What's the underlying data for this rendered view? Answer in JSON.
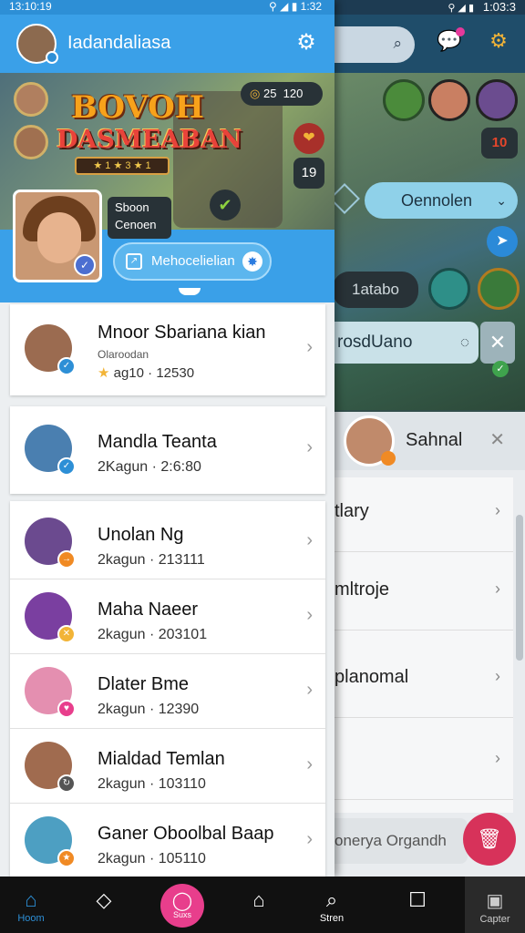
{
  "status_bar": {
    "time_left": "13:10:19",
    "time_right": "1:32",
    "time_far": "1:03:3"
  },
  "app_bar": {
    "title": "Iadandaliasa"
  },
  "banner": {
    "title_line1": "BOVOH",
    "title_line2": "DASMEABAN",
    "stars": "★ 1 ★ 3 ★ 1",
    "score_a": "25",
    "score_b": "120",
    "count": "19"
  },
  "promo": {
    "bubble_line1": "Sboon",
    "bubble_line2": "Cenoen",
    "button_label": "Mehocelielian"
  },
  "friends_top": [
    {
      "name": "Mnoor Sbariana kian",
      "tag": "Olaroodan",
      "rating": "ag10",
      "meta": "12530"
    }
  ],
  "friends_single": [
    {
      "name": "Mandla Teanta",
      "sub": "2Kagun · 2:6:80"
    }
  ],
  "friends": [
    {
      "name": "Unolan Ng",
      "sub": "2kagun · 213111"
    },
    {
      "name": "Maha Naeer",
      "sub": "2kagun · 203101"
    },
    {
      "name": "Dlater Bme",
      "sub": "2kagun · 12390"
    },
    {
      "name": "Mialdad Temlan",
      "sub": "2kagun · 103110"
    },
    {
      "name": "Ganer Oboolbal Baap",
      "sub": "2kagun · 105110"
    }
  ],
  "background_app": {
    "pill_label": "Oennolen",
    "chip_label": "1atabo",
    "input_value": "rosdUano",
    "badge_number": "10",
    "profile_name": "Sahnal",
    "list_items": [
      "tlary",
      "mltroje",
      "planomal",
      ""
    ],
    "bottom_field": "onerya Organdh"
  },
  "nav": {
    "home": "Hoom",
    "fab": "Suxs",
    "search": "Stren",
    "last": "Capter"
  },
  "colors": {
    "accent": "#3aa0e8",
    "fab": "#e83e8c",
    "fab_bg": "#d7325a"
  }
}
